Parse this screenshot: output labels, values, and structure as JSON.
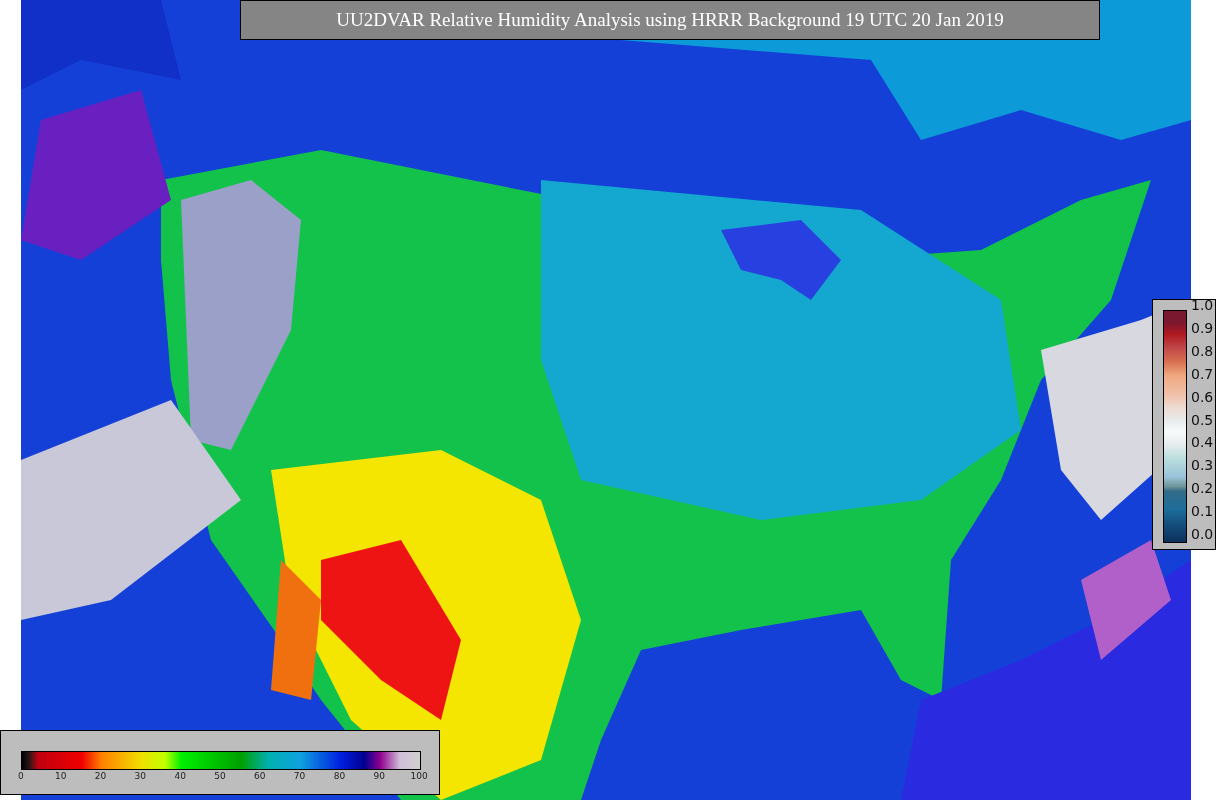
{
  "title": "UU2DVAR Relative Humidity Analysis using HRRR Background 19 UTC 20 Jan 2019",
  "error_legend": {
    "ticks": [
      "1.0",
      "0.9",
      "0.8",
      "0.7",
      "0.6",
      "0.5",
      "0.4",
      "0.3",
      "0.2",
      "0.1",
      "0.0"
    ]
  },
  "humidity_legend": {
    "ticks": [
      "0",
      "10",
      "20",
      "30",
      "40",
      "50",
      "60",
      "70",
      "80",
      "90",
      "100"
    ]
  }
}
